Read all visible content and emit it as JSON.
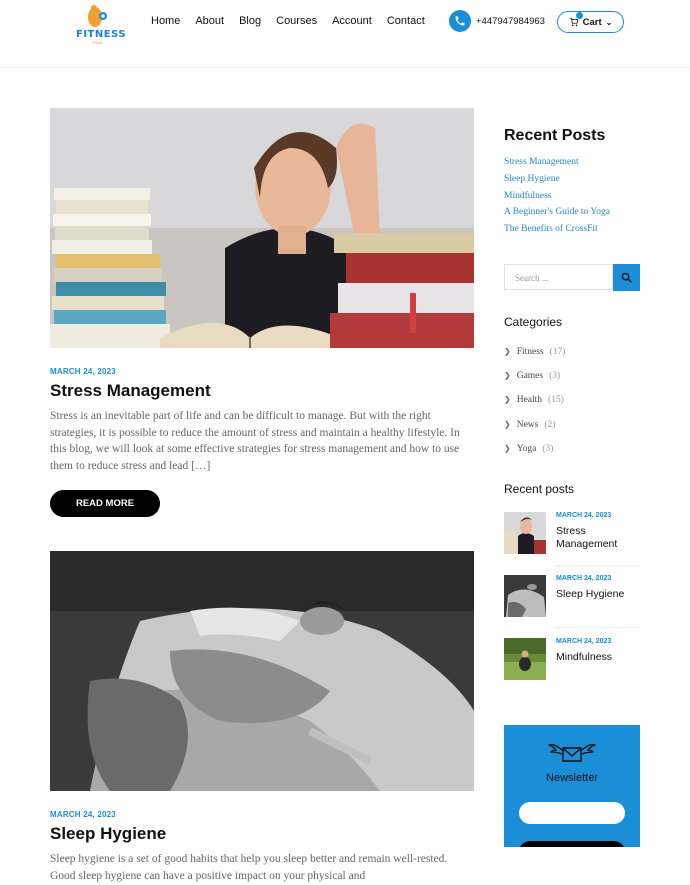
{
  "logo": {
    "text": "FITNESS",
    "sub": "TRAIL"
  },
  "nav": [
    "Home",
    "About",
    "Blog",
    "Courses",
    "Account",
    "Contact"
  ],
  "phone": "+447947984963",
  "cart": "Cart",
  "posts": [
    {
      "date": "MARCH 24, 2023",
      "title": "Stress Management",
      "excerpt": "Stress is an inevitable part of life and can be difficult to manage. But with the right strategies, it is possible to reduce the amount of stress and maintain a healthy lifestyle. In this blog, we will look at some effective strategies for stress management and how to use them to reduce stress and lead […]",
      "button": "READ MORE"
    },
    {
      "date": "MARCH 24, 2023",
      "title": "Sleep Hygiene",
      "excerpt": "Sleep hygiene is a set of good habits that help you sleep better and remain well-rested. Good sleep hygiene can have a positive impact on your physical and"
    }
  ],
  "sidebar": {
    "recent_heading": "Recent Posts",
    "recent_links": [
      "Stress Management",
      "Sleep Hygiene",
      "Mindfulness",
      "A Beginner's Guide to Yoga",
      "The Benefits of CrossFit"
    ],
    "search_placeholder": "Search ...",
    "categories_heading": "Categories",
    "categories": [
      {
        "name": "Fitness",
        "count": "(17)"
      },
      {
        "name": "Games",
        "count": "(3)"
      },
      {
        "name": "Health",
        "count": "(15)"
      },
      {
        "name": "News",
        "count": "(2)"
      },
      {
        "name": "Yoga",
        "count": "(3)"
      }
    ],
    "recent_posts_heading": "Recent posts",
    "recent_posts": [
      {
        "date": "MARCH 24, 2023",
        "title": "Stress Management"
      },
      {
        "date": "MARCH 24, 2023",
        "title": "Sleep Hygiene"
      },
      {
        "date": "MARCH 24, 2023",
        "title": "Mindfulness"
      }
    ],
    "newsletter_title": "Newsletter"
  },
  "colors": {
    "accent": "#1a8fd8",
    "link": "#2a86c8",
    "button": "#000000"
  }
}
